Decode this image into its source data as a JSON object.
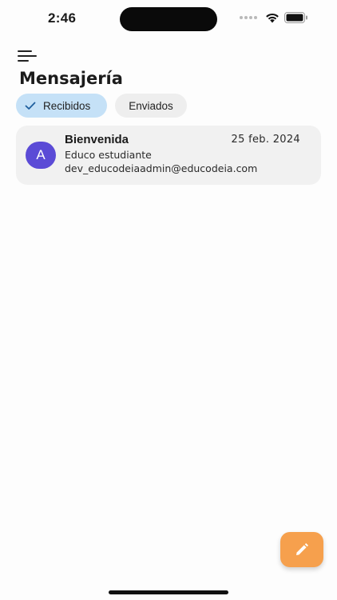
{
  "status_bar": {
    "time": "2:46",
    "icons": [
      "cellular-signal-icon",
      "wifi-icon",
      "battery-icon"
    ]
  },
  "header": {
    "menu_icon": "menu-icon",
    "title": "Mensajería"
  },
  "tabs": [
    {
      "label": "Recibidos",
      "selected": true,
      "icon": "check-icon"
    },
    {
      "label": "Enviados",
      "selected": false
    }
  ],
  "messages": [
    {
      "avatar_letter": "A",
      "subject": "Bienvenida",
      "date": "25 feb. 2024",
      "sender": "Educo estudiante",
      "email": "dev_educodeiaadmin@educodeia.com"
    }
  ],
  "fab": {
    "icon": "edit-pencil-icon"
  },
  "colors": {
    "accent_chip": "#c5e1f7",
    "avatar": "#5b4bd6",
    "fab": "#f6a04d",
    "card": "#f1f1f1"
  }
}
